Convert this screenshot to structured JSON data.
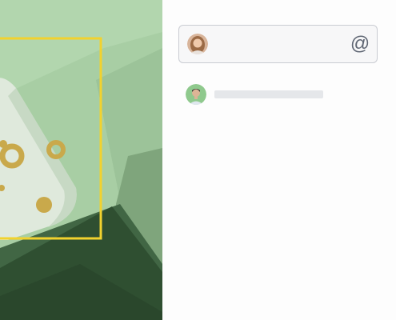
{
  "canvas": {
    "image_icon": "product-photo",
    "selection_color": "#f2d22e",
    "background_color": "#a9cfa6"
  },
  "comment_box": {
    "value": "",
    "placeholder": "",
    "avatar_icon": "user-avatar-woman",
    "mention_label": "@"
  },
  "comments": [
    {
      "avatar_icon": "user-avatar-man",
      "text": ""
    }
  ]
}
